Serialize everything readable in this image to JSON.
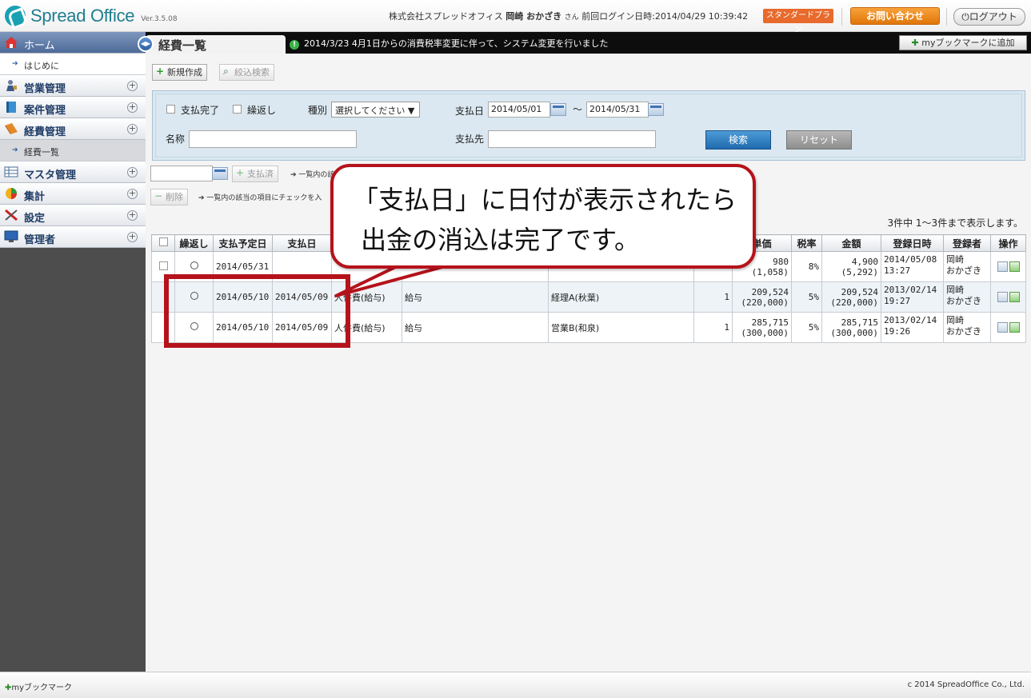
{
  "header": {
    "logo_text": "Spread Office",
    "version": "Ver.3.5.08",
    "company": "株式会社スプレッドオフィス",
    "user_name": "岡崎 おかざき",
    "honorific": "さん",
    "last_login_label": "前回ログイン日時:",
    "last_login": "2014/04/29 10:39:42",
    "plan": "スタンダードプラン",
    "contact": "お問い合わせ",
    "logout": "ログアウト"
  },
  "sidebar": {
    "home": "ホーム",
    "intro": "はじめに",
    "sales": "営業管理",
    "projects": "案件管理",
    "expenses": "経費管理",
    "expense_list": "経費一覧",
    "master": "マスタ管理",
    "summary": "集計",
    "settings": "設定",
    "admin": "管理者"
  },
  "topbar": {
    "page_title": "経費一覧",
    "notice": "2014/3/23  4月1日からの消費税率変更に伴って、システム変更を行いました",
    "bookmark_add": "myブックマークに追加"
  },
  "toolbar": {
    "new": "新規作成",
    "filter": "絞込検索"
  },
  "search": {
    "paid_done": "支払完了",
    "repeat": "繰返し",
    "type_label": "種別",
    "type_value": "選択してください ▼",
    "pay_date_label": "支払日",
    "date_from": "2014/05/01",
    "tilde": "〜",
    "date_to": "2014/05/31",
    "name_label": "名称",
    "payee_label": "支払先",
    "search_btn": "検索",
    "reset_btn": "リセット"
  },
  "actions": {
    "paid_btn": "支払済",
    "paid_hint": "一覧内の該",
    "delete_btn": "削除",
    "delete_hint": "一覧内の該当の項目にチェックを入"
  },
  "count": "3件中 1〜3件まで表示します。",
  "table": {
    "headers": [
      "",
      "繰返し",
      "支払予定日",
      "支払日",
      "",
      "",
      "",
      "",
      "単価",
      "税率",
      "金額",
      "登録日時",
      "登録者",
      "操作"
    ],
    "rows": [
      {
        "scheduled": "2014/05/31",
        "paid": "",
        "category": "",
        "item": "",
        "account": "",
        "qty": "",
        "price": "980",
        "price_tax": "(1,058)",
        "rate": "8%",
        "amount": "4,900",
        "amount_tax": "(5,292)",
        "reg_date": "2014/05/08",
        "reg_time": "13:27",
        "reg_user": "岡崎",
        "reg_user2": "おかざき"
      },
      {
        "scheduled": "2014/05/10",
        "paid": "2014/05/09",
        "category": "人件費(給与)",
        "item": "給与",
        "account": "経理A(秋葉)",
        "qty": "1",
        "price": "209,524",
        "price_tax": "(220,000)",
        "rate": "5%",
        "amount": "209,524",
        "amount_tax": "(220,000)",
        "reg_date": "2013/02/14",
        "reg_time": "19:27",
        "reg_user": "岡崎",
        "reg_user2": "おかざき"
      },
      {
        "scheduled": "2014/05/10",
        "paid": "2014/05/09",
        "category": "人件費(給与)",
        "item": "給与",
        "account": "営業B(和泉)",
        "qty": "1",
        "price": "285,715",
        "price_tax": "(300,000)",
        "rate": "5%",
        "amount": "285,715",
        "amount_tax": "(300,000)",
        "reg_date": "2013/02/14",
        "reg_time": "19:26",
        "reg_user": "岡崎",
        "reg_user2": "おかざき"
      }
    ]
  },
  "footer": {
    "bookmark": "myブックマーク",
    "copyright": "c 2014 SpreadOffice Co., Ltd."
  },
  "callout": {
    "text": "「支払日」に日付が表示されたら\n 出金の消込は完了です。"
  },
  "colors": {
    "accent_red": "#b5121b",
    "header_teal": "#1f7e90",
    "nav_blue": "#4d6a98"
  }
}
